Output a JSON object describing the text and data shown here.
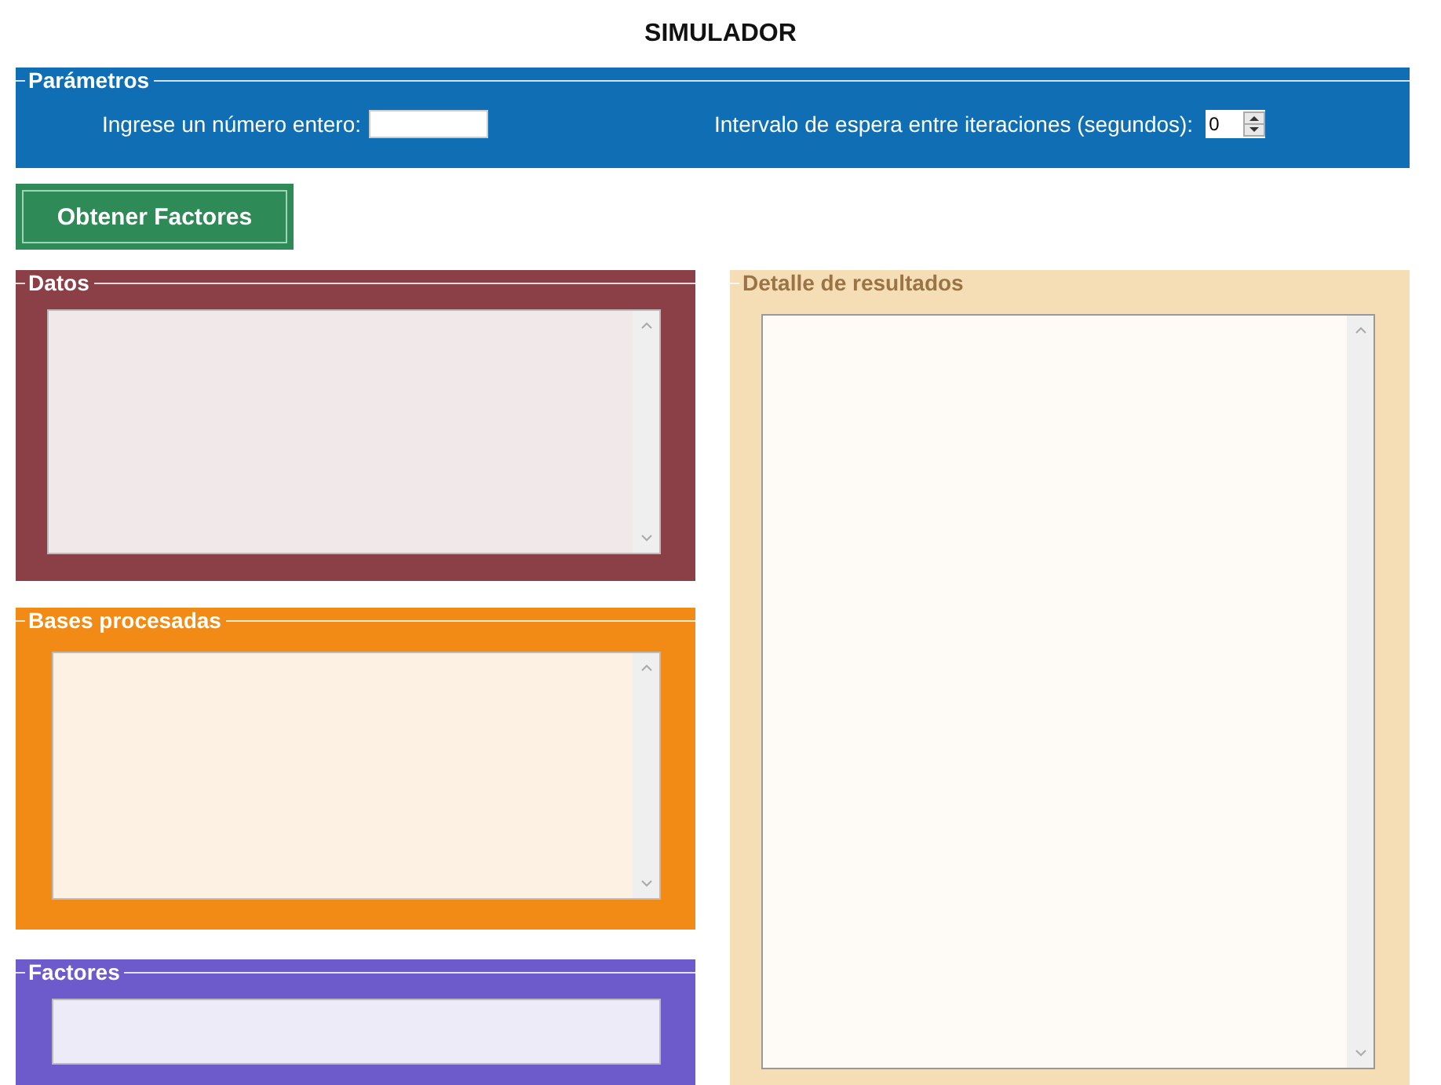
{
  "title": "SIMULADOR",
  "parameters": {
    "title": "Parámetros",
    "color": "#106eb4",
    "number_label": "Ingrese un número entero:",
    "interval_label": "Intervalo de espera entre iteraciones (segundos):",
    "interval_value": "0"
  },
  "action_button": {
    "label": "Obtener Factores"
  },
  "left_panels": [
    {
      "title": "Datos",
      "color": "#8b3f47",
      "kind": "multiline"
    },
    {
      "title": "Bases procesadas",
      "color": "#f28a16",
      "kind": "multiline"
    },
    {
      "title": "Factores",
      "color": "#6e5bcb",
      "kind": "single"
    }
  ],
  "results_panel": {
    "title": "Detalle de resultados",
    "color": "#f5deb5",
    "kind": "multiline"
  }
}
